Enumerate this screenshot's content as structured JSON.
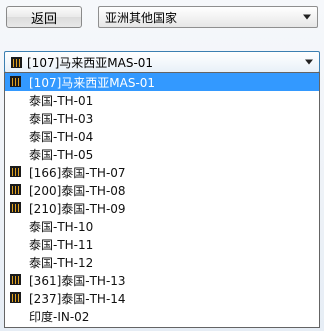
{
  "back_button": {
    "label": "返回"
  },
  "region_select": {
    "value": "亚洲其他国家"
  },
  "station_select": {
    "value": "[107]马来西亚MAS-01",
    "icon": "station-bars-icon"
  },
  "dropdown": {
    "items": [
      {
        "label": "[107]马来西亚MAS-01",
        "icon": "station-bars-icon",
        "selected": true
      },
      {
        "label": "泰国-TH-01",
        "icon": "",
        "selected": false
      },
      {
        "label": "泰国-TH-03",
        "icon": "",
        "selected": false
      },
      {
        "label": "泰国-TH-04",
        "icon": "",
        "selected": false
      },
      {
        "label": "泰国-TH-05",
        "icon": "",
        "selected": false
      },
      {
        "label": "[166]泰国-TH-07",
        "icon": "station-bars-icon",
        "selected": false
      },
      {
        "label": "[200]泰国-TH-08",
        "icon": "station-bars-icon",
        "selected": false
      },
      {
        "label": "[210]泰国-TH-09",
        "icon": "station-bars-icon",
        "selected": false
      },
      {
        "label": "泰国-TH-10",
        "icon": "",
        "selected": false
      },
      {
        "label": "泰国-TH-11",
        "icon": "",
        "selected": false
      },
      {
        "label": "泰国-TH-12",
        "icon": "",
        "selected": false
      },
      {
        "label": "[361]泰国-TH-13",
        "icon": "station-bars-icon",
        "selected": false
      },
      {
        "label": "[237]泰国-TH-14",
        "icon": "station-bars-icon",
        "selected": false
      },
      {
        "label": "印度-IN-02",
        "icon": "",
        "selected": false
      }
    ]
  },
  "colors": {
    "selection": "#3399ff",
    "icon_bg": "#1a1a1a",
    "icon_bars": "#e0a020"
  }
}
